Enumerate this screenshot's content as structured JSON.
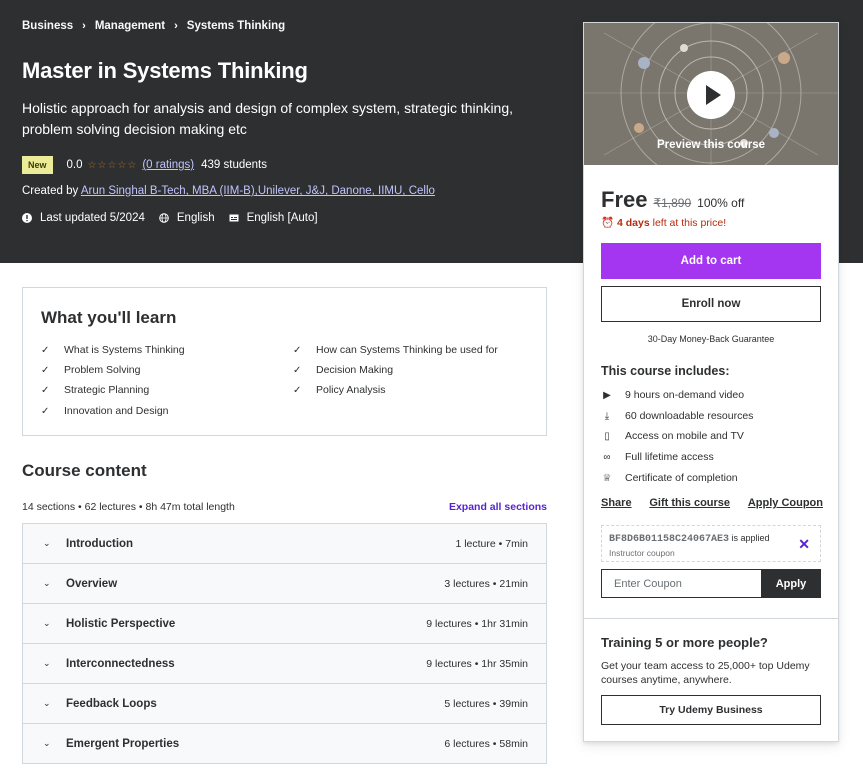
{
  "breadcrumb": [
    "Business",
    "Management",
    "Systems Thinking"
  ],
  "course": {
    "title": "Master in Systems Thinking",
    "subtitle": "Holistic approach for analysis and design of complex system, strategic thinking, problem solving decision making etc",
    "badge": "New",
    "rating": "0.0",
    "ratings_link": "(0 ratings)",
    "students": "439 students",
    "created_by_label": "Created by",
    "author": "Arun Singhal B-Tech, MBA (IIM-B),Unilever, J&J, Danone, IIMU, Cello",
    "last_updated": "Last updated 5/2024",
    "language": "English",
    "captions": "English [Auto]"
  },
  "learn": {
    "title": "What you'll learn",
    "items": [
      "What is Systems Thinking",
      "How can Systems Thinking be used for",
      "Problem Solving",
      "Decision Making",
      "Strategic Planning",
      "Policy Analysis",
      "Innovation and Design"
    ]
  },
  "content": {
    "title": "Course content",
    "summary": "14 sections • 62 lectures • 8h 47m total length",
    "expand": "Expand all sections",
    "sections": [
      {
        "name": "Introduction",
        "length": "1 lecture • 7min"
      },
      {
        "name": "Overview",
        "length": "3 lectures • 21min"
      },
      {
        "name": "Holistic Perspective",
        "length": "9 lectures • 1hr 31min"
      },
      {
        "name": "Interconnectedness",
        "length": "9 lectures • 1hr 35min"
      },
      {
        "name": "Feedback Loops",
        "length": "5 lectures • 39min"
      },
      {
        "name": "Emergent Properties",
        "length": "6 lectures • 58min"
      }
    ]
  },
  "sidebar": {
    "preview_label": "Preview this course",
    "price": "Free",
    "original_price": "₹1,890",
    "discount": "100% off",
    "timer_bold": "4 days",
    "timer_rest": " left at this price!",
    "add_to_cart": "Add to cart",
    "enroll": "Enroll now",
    "guarantee": "30-Day Money-Back Guarantee",
    "includes_title": "This course includes:",
    "includes": [
      {
        "icon": "video-icon",
        "text": "9 hours on-demand video"
      },
      {
        "icon": "download-icon",
        "text": "60 downloadable resources"
      },
      {
        "icon": "mobile-icon",
        "text": "Access on mobile and TV"
      },
      {
        "icon": "infinity-icon",
        "text": "Full lifetime access"
      },
      {
        "icon": "trophy-icon",
        "text": "Certificate of completion"
      }
    ],
    "share": "Share",
    "gift": "Gift this course",
    "apply_coupon": "Apply Coupon",
    "coupon_code": "BF8D6B01158C24067AE3",
    "coupon_applied": " is applied",
    "coupon_sub": "Instructor coupon",
    "coupon_placeholder": "Enter Coupon",
    "apply": "Apply",
    "training_title": "Training 5 or more people?",
    "training_text": "Get your team access to 25,000+ top Udemy courses anytime, anywhere.",
    "business_button": "Try Udemy Business"
  },
  "colors": {
    "hero_bg": "#2d2f31",
    "accent_purple": "#a435f0",
    "link_purple": "#5624d0",
    "timer_red": "#b32d0f",
    "star_orange": "#b4690e"
  }
}
